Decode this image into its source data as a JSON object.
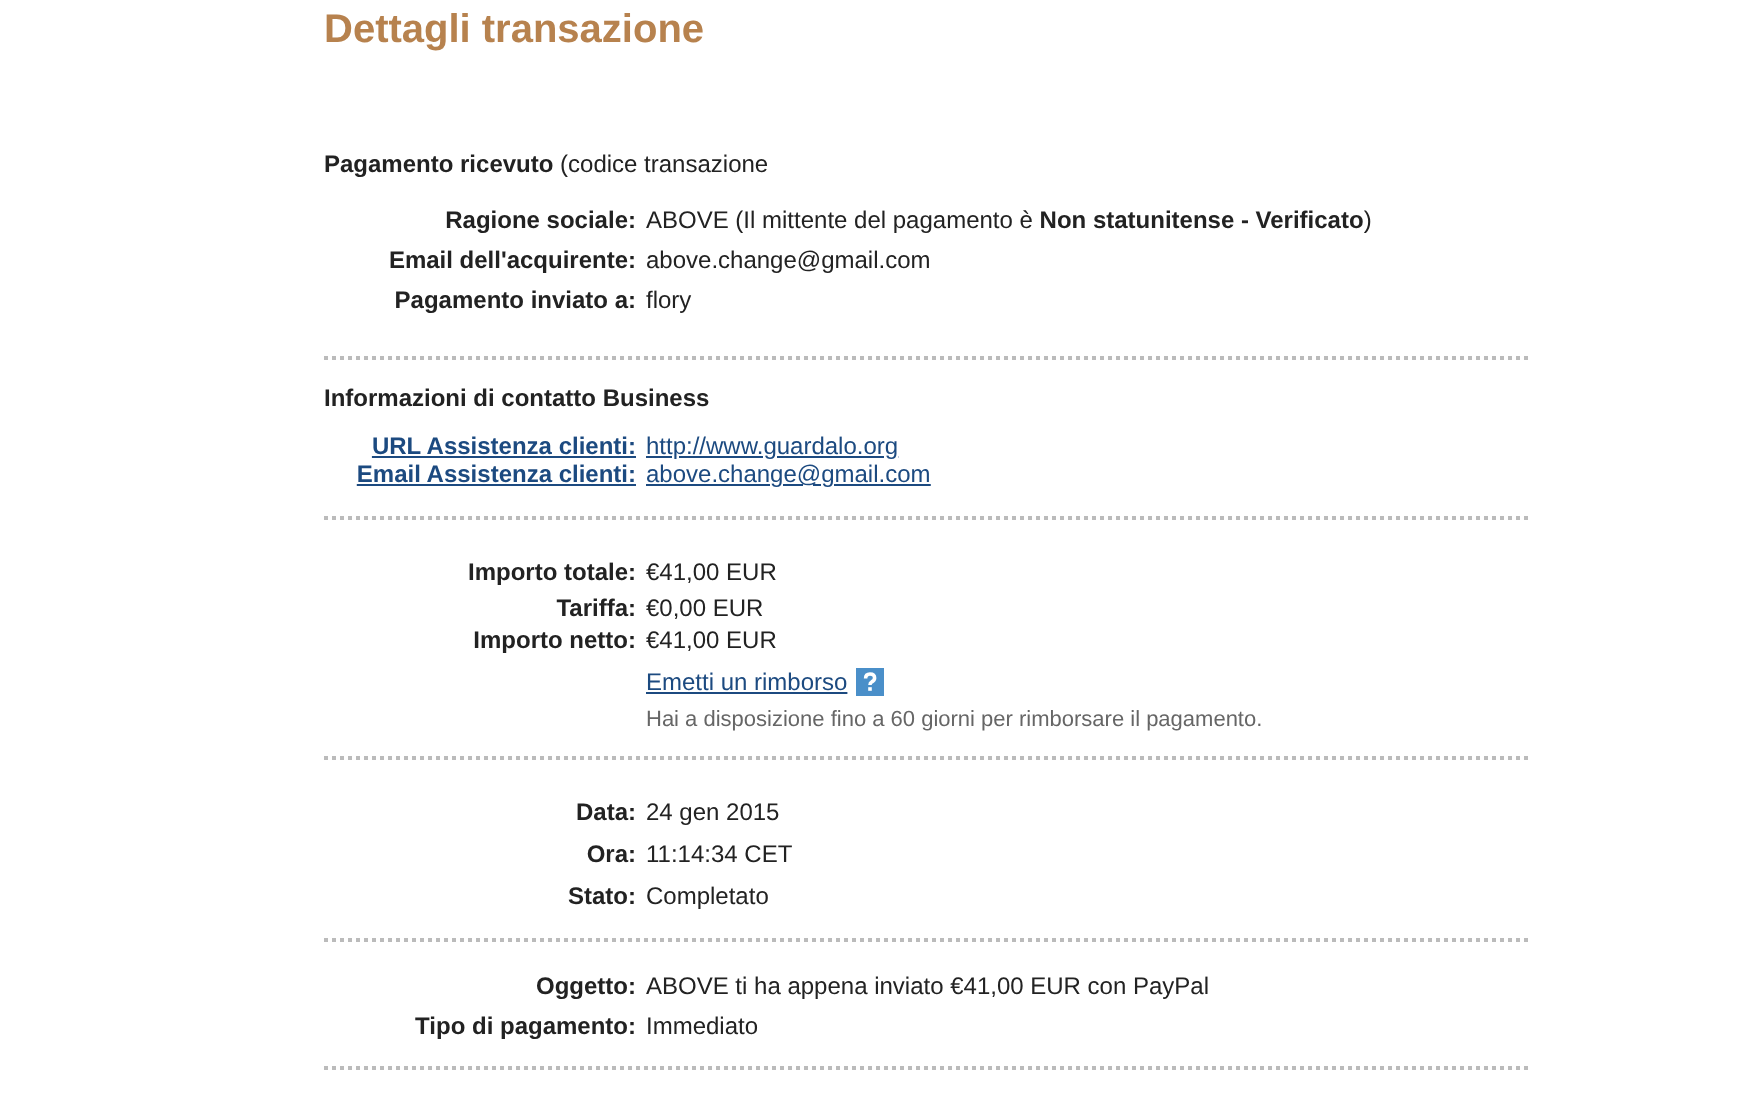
{
  "title": "Dettagli transazione",
  "sections": [
    {
      "header": "**Pagamento ricevuto** (codice transazione",
      "rows": [
        {
          "label": "Ragione sociale:",
          "value": "ABOVE (Il mittente del pagamento è **Non statunitense - Verificato**)",
          "kind": "text"
        },
        {
          "label": "Email dell'acquirente:",
          "value": "above.change@gmail.com",
          "kind": "text"
        },
        {
          "label": "Pagamento inviato a:",
          "value": "flory",
          "kind": "text"
        }
      ]
    },
    {
      "header": "**Informazioni di contatto Business**",
      "rows": [
        {
          "label": "URL Assistenza clienti:",
          "value": "http://www.guardalo.org",
          "kind": "link"
        },
        {
          "label": "Email Assistenza clienti:",
          "value": "above.change@gmail.com",
          "kind": "link"
        }
      ]
    },
    {
      "rows": [
        {
          "label": "Importo totale:",
          "value": "€41,00 EUR",
          "kind": "text"
        },
        {
          "label": "Tariffa:",
          "value": "€0,00 EUR",
          "kind": "text"
        },
        {
          "label": "Importo netto:",
          "value": "€41,00 EUR",
          "kind": "text"
        },
        {
          "value": "Emetti un rimborso",
          "kind": "refund"
        },
        {
          "value": "Hai a disposizione fino a 60 giorni per rimborsare il pagamento.",
          "kind": "note"
        }
      ]
    },
    {
      "rows": [
        {
          "label": "Data:",
          "value": "24 gen 2015",
          "kind": "text"
        },
        {
          "label": "Ora:",
          "value": "11:14:34 CET",
          "kind": "text"
        },
        {
          "label": "Stato:",
          "value": "Completato",
          "kind": "text"
        }
      ]
    },
    {
      "rows": [
        {
          "label": "Oggetto:",
          "value": "ABOVE ti ha appena inviato €41,00 EUR con PayPal",
          "kind": "text"
        },
        {
          "label": "Tipo di pagamento:",
          "value": "Immediato",
          "kind": "text"
        }
      ]
    }
  ]
}
